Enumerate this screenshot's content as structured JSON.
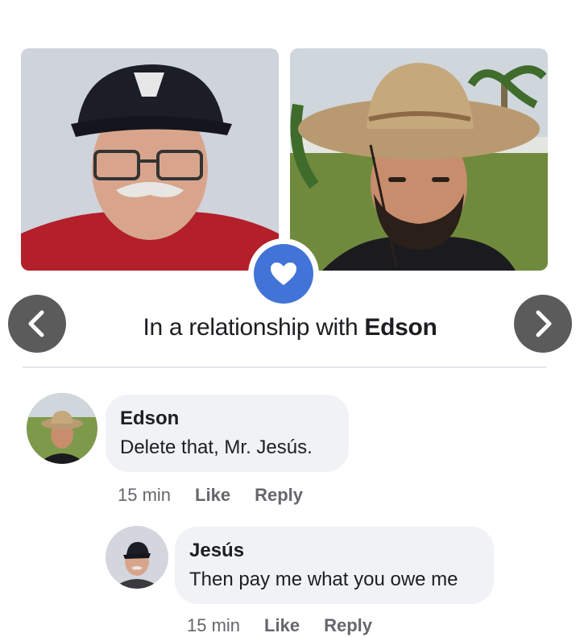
{
  "relationship": {
    "prefix": "In a relationship with ",
    "partner": "Edson"
  },
  "colors": {
    "accent": "#4273d6",
    "bubble": "#f0f2f5",
    "meta_text": "#65676b",
    "arrow_bg": "#5b5b5b"
  },
  "icons": {
    "badge": "heart-icon",
    "prev": "chevron-left-icon",
    "next": "chevron-right-icon"
  },
  "comments": [
    {
      "author": "Edson",
      "text": "Delete that, Mr. Jesús.",
      "time": "15 min",
      "like_label": "Like",
      "reply_label": "Reply"
    },
    {
      "author": "Jesús",
      "text": "Then pay me what you owe me",
      "time": "15 min",
      "like_label": "Like",
      "reply_label": "Reply"
    }
  ]
}
